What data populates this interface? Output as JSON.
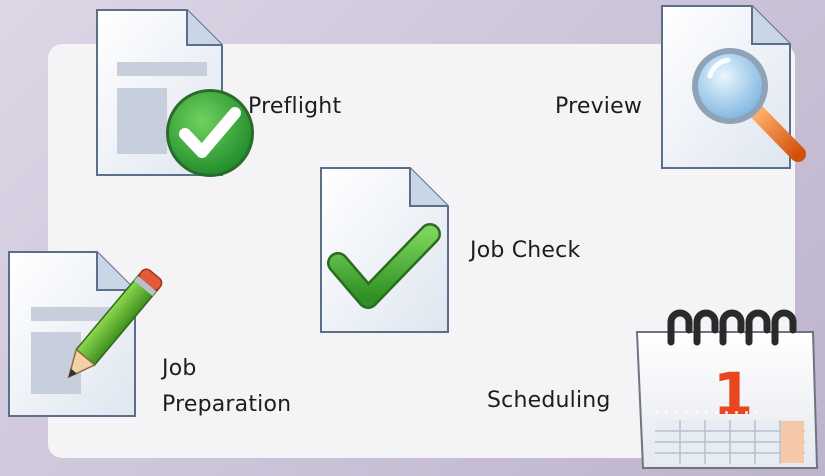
{
  "tools": {
    "preflight": {
      "label": "Preflight",
      "icon": "document-check-badge-icon"
    },
    "preview": {
      "label": "Preview",
      "icon": "document-magnifier-icon"
    },
    "job_check": {
      "label": "Job Check",
      "icon": "document-checkmark-icon"
    },
    "job_preparation": {
      "label_line1": "Job",
      "label_line2": "Preparation",
      "icon": "document-pencil-icon"
    },
    "scheduling": {
      "label": "Scheduling",
      "icon": "calendar-icon",
      "calendar_day": "1"
    }
  },
  "colors": {
    "background": "#cbc3d8",
    "panel": "#f4f3f6",
    "check_green": "#3fa83a",
    "calendar_red": "#e8461e",
    "pencil_green": "#5aa828"
  }
}
